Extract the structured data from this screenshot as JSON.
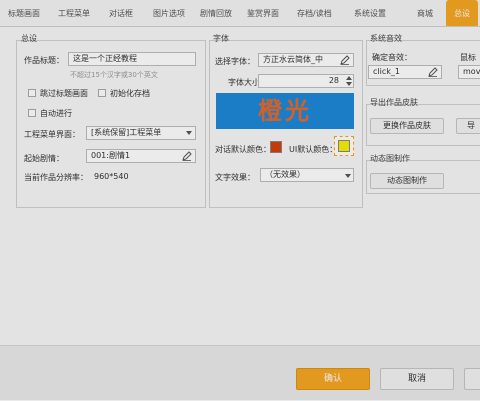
{
  "tabs": [
    {
      "label": "标题画面"
    },
    {
      "label": "工程菜单"
    },
    {
      "label": "对话框"
    },
    {
      "label": "图片选项"
    },
    {
      "label": "剧情回放"
    },
    {
      "label": "鉴赏界面"
    },
    {
      "label": "存档/读档"
    },
    {
      "label": "系统设置"
    },
    {
      "label": "商城"
    },
    {
      "label": "总设"
    }
  ],
  "general": {
    "title": "总设",
    "work_title_label": "作品标题：",
    "work_title_value": "这是一个正经教程",
    "work_title_hint": "不超过15个汉字或30个英文",
    "skip_title_label": "跳过标题画面",
    "init_save_label": "初始化存档",
    "autoplay_label": "自动进行",
    "menu_label": "工程菜单界面：",
    "menu_value": "[系统保留]工程菜单",
    "start_label": "起始剧情：",
    "start_value": "001:剧情1",
    "resolution_label": "当前作品分辨率：",
    "resolution_value": "960*540"
  },
  "font": {
    "title": "字体",
    "choose_label": "选择字体：",
    "choose_value": "方正水云简体_中",
    "size_label": "字体大小：",
    "size_value": "28",
    "preview_text": "橙光",
    "dialog_color_label": "对话默认颜色：",
    "dialog_color": "#d2400e",
    "ui_color_label": "UI默认颜色：",
    "ui_color": "#f8f000",
    "effect_label": "文字效果：",
    "effect_value": "（无效果）"
  },
  "sound": {
    "title": "系统音效",
    "confirm_label": "确定音效：",
    "confirm_value": "click_1",
    "mouse_label": "鼠标",
    "mouse_value": "move"
  },
  "skin": {
    "title": "导出作品皮肤",
    "change_label": "更换作品皮肤",
    "export_label": "导"
  },
  "anim": {
    "title": "动态图制作",
    "button_label": "动态图制作"
  },
  "footer": {
    "ok_label": "确认",
    "cancel_label": "取消"
  },
  "colors": {
    "accent": "#f5a623",
    "preview_bg": "#1e88d6",
    "preview_text": "#e8692a"
  }
}
